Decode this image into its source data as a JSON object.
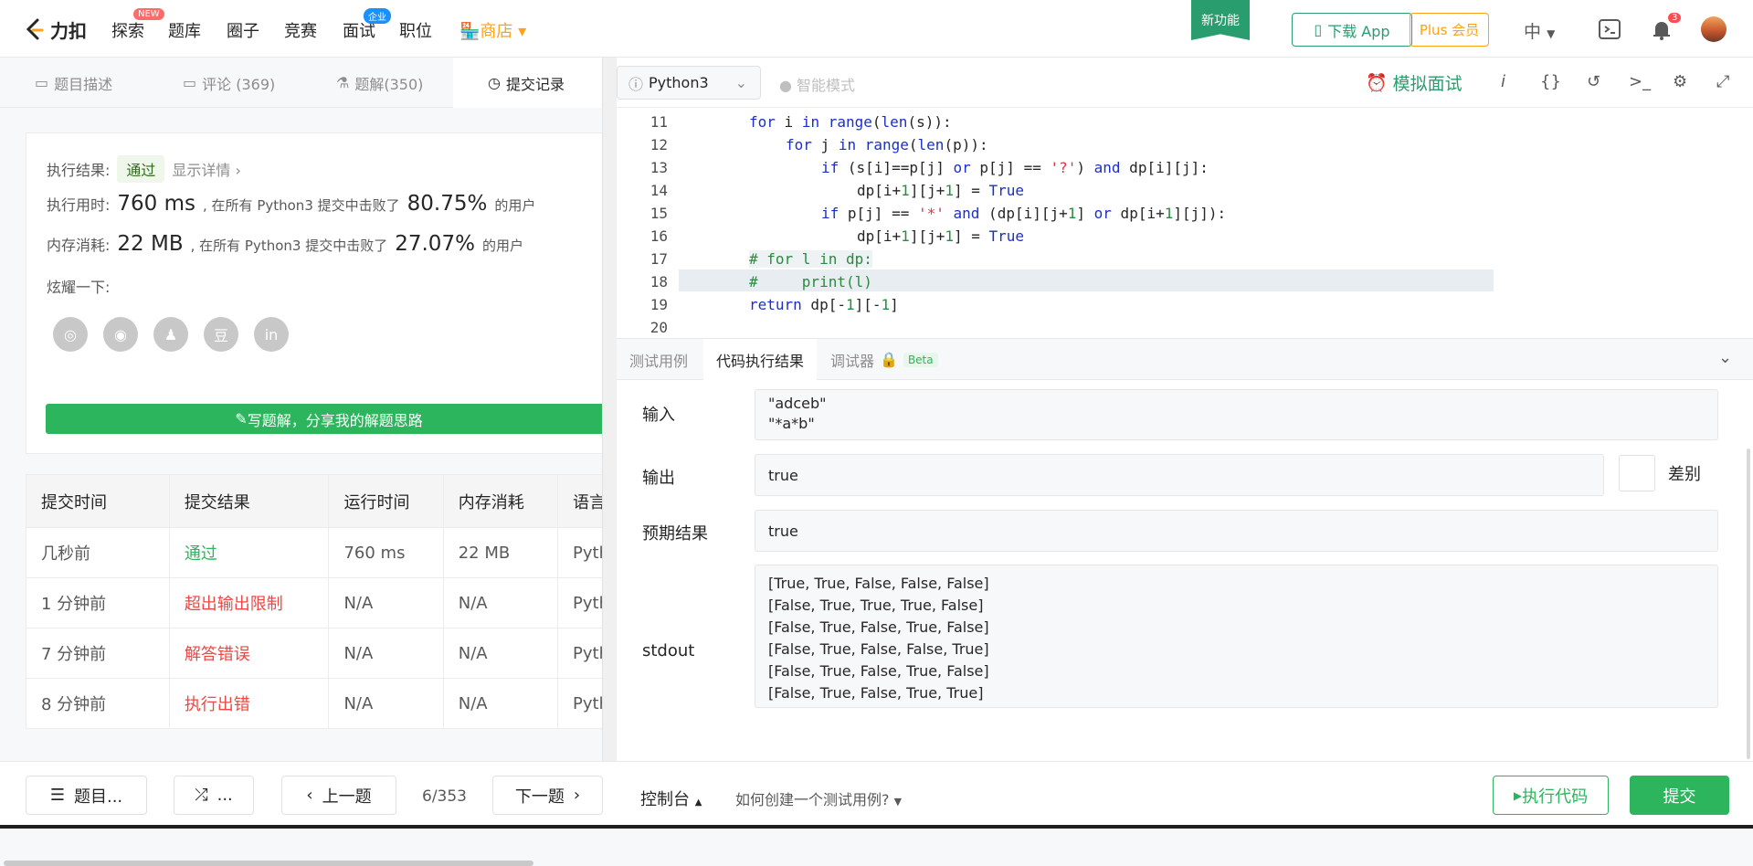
{
  "nav": {
    "logo_text": "力扣",
    "items": [
      "探索",
      "题库",
      "圈子",
      "竞赛",
      "面试",
      "职位"
    ],
    "badge_new": "NEW",
    "badge_enterprise": "企业",
    "shop": "商店",
    "new_feature": "新功能",
    "download_app": "下载 App",
    "plus": "Plus 会员",
    "lang": "中",
    "notif_count": "3"
  },
  "left": {
    "tabs": [
      "题目描述",
      "评论 (369)",
      "题解(350)",
      "提交记录"
    ],
    "result_label": "执行结果:",
    "result_value": "通过",
    "show_detail": "显示详情 ›",
    "time_label": "执行用时:",
    "time_value": "760 ms",
    "time_mid": ", 在所有 Python3 提交中击败了",
    "time_pct": "80.75%",
    "time_tail": "的用户",
    "mem_label": "内存消耗:",
    "mem_value": "22 MB",
    "mem_mid": ", 在所有 Python3 提交中击败了",
    "mem_pct": "27.07%",
    "mem_tail": "的用户",
    "share_label": "炫耀一下:",
    "write_button": "写题解，分享我的解题思路",
    "table": {
      "headers": [
        "提交时间",
        "提交结果",
        "运行时间",
        "内存消耗",
        "语言"
      ],
      "rows": [
        {
          "time": "几秒前",
          "result": "通过",
          "runtime": "760 ms",
          "memory": "22 MB",
          "lang": "Pyth"
        },
        {
          "time": "1 分钟前",
          "result": "超出输出限制",
          "runtime": "N/A",
          "memory": "N/A",
          "lang": "Pyth"
        },
        {
          "time": "7 分钟前",
          "result": "解答错误",
          "runtime": "N/A",
          "memory": "N/A",
          "lang": "Pyth"
        },
        {
          "time": "8 分钟前",
          "result": "执行出错",
          "runtime": "N/A",
          "memory": "N/A",
          "lang": "Pyth"
        }
      ]
    }
  },
  "editor": {
    "language": "Python3",
    "smart_mode": "智能模式",
    "mock_interview": "模拟面试",
    "lines": [
      {
        "n": "11",
        "code": "for i in range(len(s)):"
      },
      {
        "n": "12",
        "code": "for j in range(len(p)):"
      },
      {
        "n": "13",
        "code": "if (s[i]==p[j] or p[j] == '?') and dp[i][j]:"
      },
      {
        "n": "14",
        "code": "dp[i+1][j+1] = True"
      },
      {
        "n": "15",
        "code": "if p[j] == '*' and (dp[i][j+1] or dp[i+1][j]):"
      },
      {
        "n": "16",
        "code": "dp[i+1][j+1] = True"
      },
      {
        "n": "17",
        "code": "# for l in dp:"
      },
      {
        "n": "18",
        "code": "#     print(l)"
      },
      {
        "n": "19",
        "code": "return dp[-1][-1]"
      },
      {
        "n": "20",
        "code": ""
      }
    ]
  },
  "console": {
    "tabs": [
      "测试用例",
      "代码执行结果",
      "调试器"
    ],
    "beta": "Beta",
    "input_label": "输入",
    "input_value": "\"adceb\"\n\"*a*b\"",
    "output_label": "输出",
    "output_value": "true",
    "diff_label": "差别",
    "expected_label": "预期结果",
    "expected_value": "true",
    "stdout_label": "stdout",
    "stdout_value": "[True, True, False, False, False]\n[False, True, True, True, False]\n[False, True, False, True, False]\n[False, True, False, False, True]\n[False, True, False, True, False]\n[False, True, False, True, True]"
  },
  "footer": {
    "problem_list": "题目...",
    "random": "...",
    "prev": "上一题",
    "page": "6/353",
    "next": "下一题",
    "console": "控制台",
    "how_test": "如何创建一个测试用例?",
    "run": "执行代码",
    "submit": "提交"
  },
  "colors": {
    "green": "#2db55d",
    "brand": "#2a9d6f",
    "orange": "#ffa116",
    "red": "#ef4743"
  }
}
